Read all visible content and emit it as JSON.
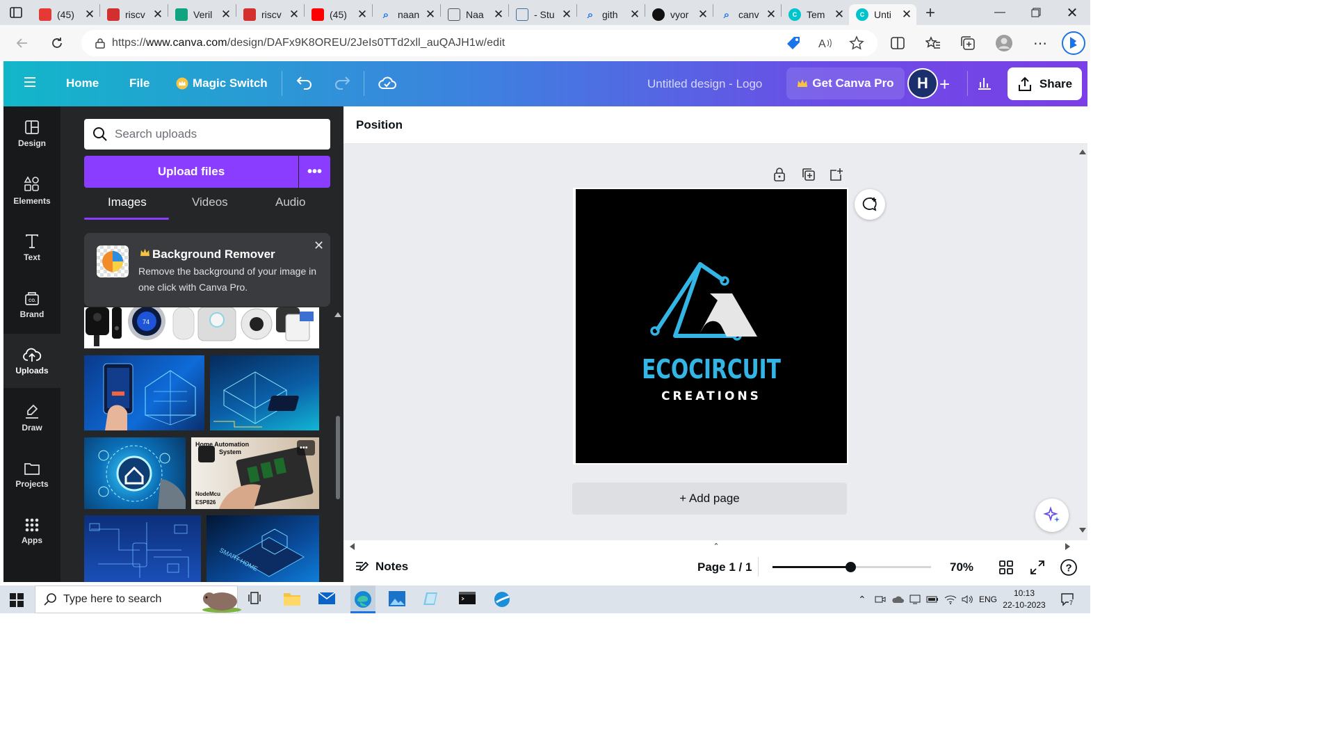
{
  "browser": {
    "tabs": [
      {
        "title": "(45)",
        "icon": "youtube-icon",
        "color": "#e53935"
      },
      {
        "title": "riscv",
        "icon": "pdf-icon",
        "color": "#d32f2f"
      },
      {
        "title": "Veril",
        "icon": "chatgpt-icon",
        "color": "#10a37f"
      },
      {
        "title": "riscv",
        "icon": "pdf-icon",
        "color": "#d32f2f"
      },
      {
        "title": "(45)",
        "icon": "youtube-icon",
        "color": "#ff0000"
      },
      {
        "title": "naan",
        "icon": "search-icon",
        "color": "#1a73e8"
      },
      {
        "title": "Naa",
        "icon": "document-icon",
        "color": "#555555"
      },
      {
        "title": "- Stu",
        "icon": "chart-icon",
        "color": "#3c6e9f"
      },
      {
        "title": "gith",
        "icon": "search-icon",
        "color": "#1a73e8"
      },
      {
        "title": "vyor",
        "icon": "github-icon",
        "color": "#111111"
      },
      {
        "title": "canv",
        "icon": "search-icon",
        "color": "#1a73e8"
      },
      {
        "title": "Tem",
        "icon": "canva-icon",
        "color": "#00c4cc"
      },
      {
        "title": "Unti",
        "icon": "canva-icon",
        "color": "#00c4cc"
      }
    ],
    "url_prefix": "https://",
    "url_domain": "www.canva.com",
    "url_path": "/design/DAFx9K8OREU/2JeIs0TTd2xll_auQAJH1w/edit"
  },
  "header": {
    "home": "Home",
    "file": "File",
    "magic_switch": "Magic Switch",
    "design_title": "Untitled design - Logo",
    "get_pro": "Get Canva Pro",
    "avatar_letter": "H",
    "share": "Share",
    "colors": {
      "gradient_start": "#12b7c9",
      "gradient_end": "#7a3fe6",
      "crown": "#f6c344"
    }
  },
  "rail": [
    {
      "label": "Design",
      "icon": "design-icon"
    },
    {
      "label": "Elements",
      "icon": "elements-icon"
    },
    {
      "label": "Text",
      "icon": "text-icon"
    },
    {
      "label": "Brand",
      "icon": "brand-icon"
    },
    {
      "label": "Uploads",
      "icon": "upload-cloud-icon",
      "active": true
    },
    {
      "label": "Draw",
      "icon": "draw-icon"
    },
    {
      "label": "Projects",
      "icon": "folder-icon"
    },
    {
      "label": "Apps",
      "icon": "apps-grid-icon"
    }
  ],
  "panel": {
    "search_placeholder": "Search uploads",
    "upload_button": "Upload files",
    "tabs": [
      "Images",
      "Videos",
      "Audio"
    ],
    "active_tab": "Images",
    "promo": {
      "title": "Background Remover",
      "body": "Remove the background of your image in one click with Canva Pro."
    },
    "thumb_texts": {
      "thermostat": "74",
      "automation_title_1": "Home Automation",
      "automation_title_2": "System",
      "automation_board": "NodeMcu",
      "automation_board_2": "ESP826",
      "smart_home": "SMART HOME"
    },
    "accent": "#8b3dff"
  },
  "editor": {
    "toolbar_label": "Position",
    "logo_text": "ECOCIRCUIT",
    "logo_subtext": "CREATIONS",
    "logo_color": "#33b5e5",
    "add_page": "+ Add page"
  },
  "footer": {
    "notes": "Notes",
    "page_counter": "Page 1 / 1",
    "zoom": "70%",
    "zoom_level": 0.7
  },
  "taskbar": {
    "search_placeholder": "Type here to search",
    "language": "ENG",
    "time": "10:13",
    "date": "22-10-2023",
    "notification_count": "7"
  }
}
